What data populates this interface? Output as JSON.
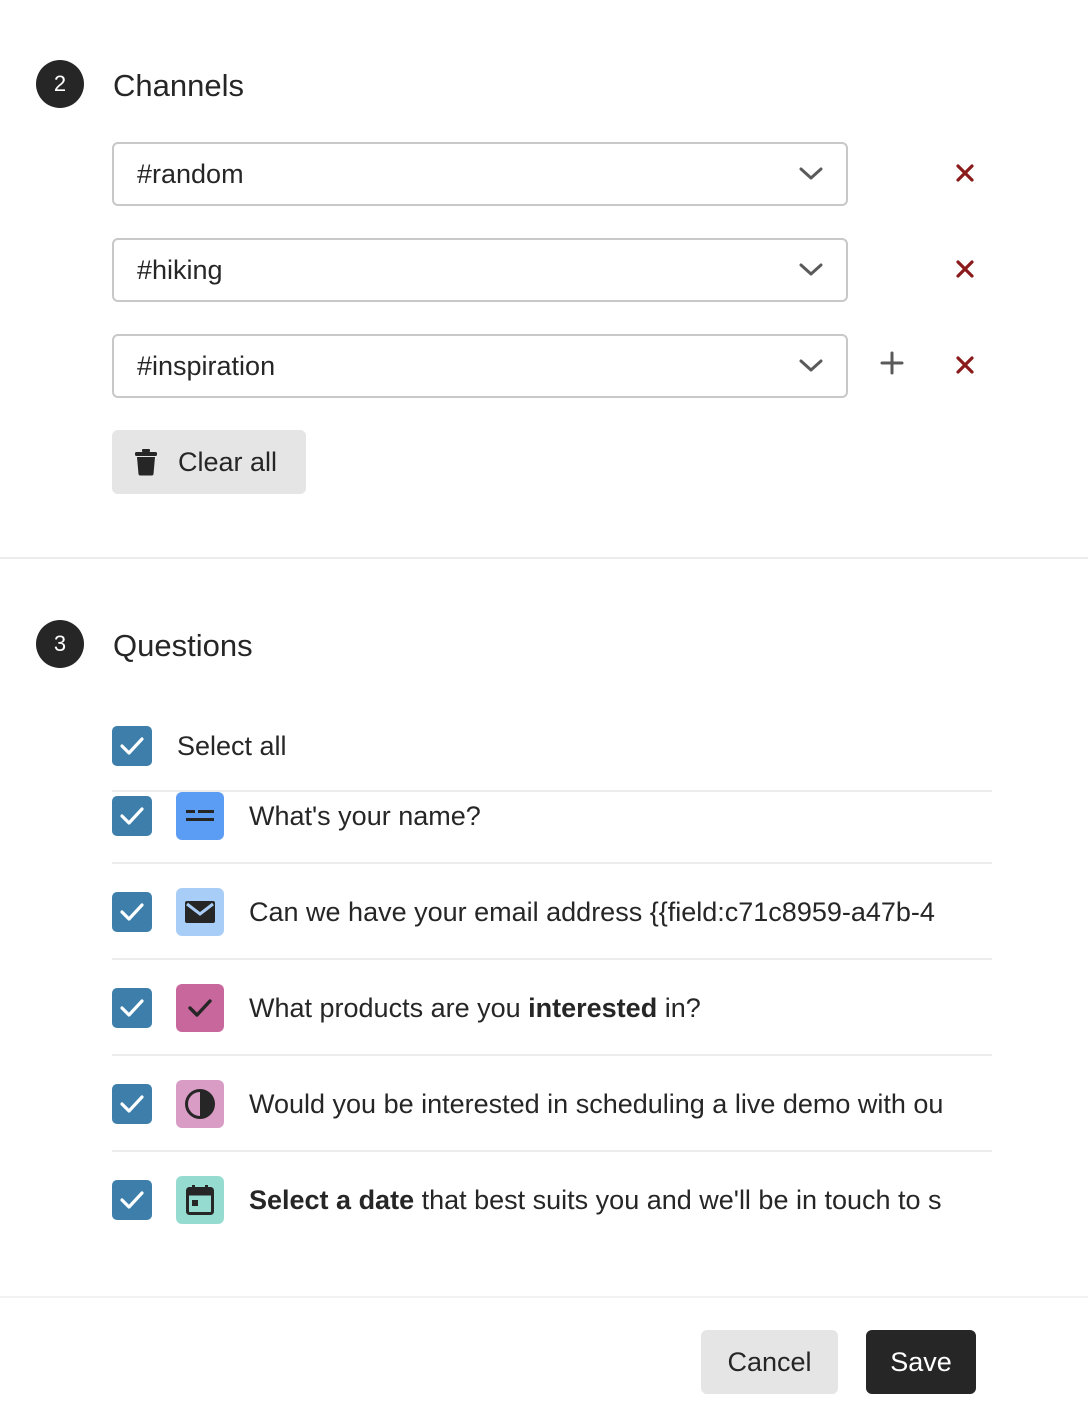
{
  "channels_section": {
    "step_number": "2",
    "title": "Channels",
    "channels": [
      {
        "value": "#random"
      },
      {
        "value": "#hiking"
      },
      {
        "value": "#inspiration"
      }
    ],
    "clear_all_label": "Clear all"
  },
  "questions_section": {
    "step_number": "3",
    "title": "Questions",
    "select_all_label": "Select all",
    "questions": [
      {
        "parts": [
          {
            "text": "What's your name?",
            "bold": false
          }
        ],
        "icon": "short-text-icon",
        "icon_color": "#5b9cf4"
      },
      {
        "parts": [
          {
            "text": "Can we have your email address {{field:c71c8959-a47b-4",
            "bold": false
          }
        ],
        "icon": "email-icon",
        "icon_color": "#a8cdf6"
      },
      {
        "parts": [
          {
            "text": "What products are you ",
            "bold": false
          },
          {
            "text": "interested",
            "bold": true
          },
          {
            "text": " in?",
            "bold": false
          }
        ],
        "icon": "multiple-choice-icon",
        "icon_color": "#c8679b"
      },
      {
        "parts": [
          {
            "text": "Would you be interested in scheduling a live demo with ou",
            "bold": false
          }
        ],
        "icon": "yes-no-icon",
        "icon_color": "#d99cc4"
      },
      {
        "parts": [
          {
            "text": "Select a date",
            "bold": true
          },
          {
            "text": " that best suits you and we'll be in touch to s",
            "bold": false
          }
        ],
        "icon": "calendar-icon",
        "icon_color": "#96dbd0"
      }
    ]
  },
  "footer": {
    "cancel_label": "Cancel",
    "save_label": "Save"
  },
  "colors": {
    "checkbox": "#3d7faa",
    "remove": "#8b1a1a",
    "dark": "#262627"
  }
}
